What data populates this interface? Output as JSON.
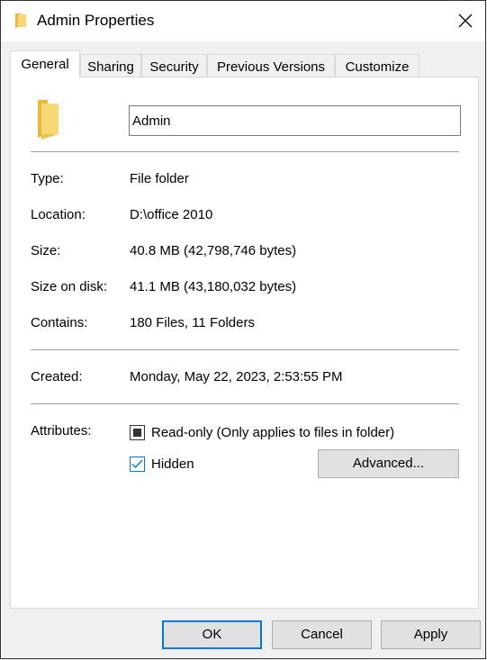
{
  "window": {
    "title": "Admin Properties",
    "close_icon": "close-icon"
  },
  "tabs": [
    {
      "label": "General",
      "active": true
    },
    {
      "label": "Sharing",
      "active": false
    },
    {
      "label": "Security",
      "active": false
    },
    {
      "label": "Previous Versions",
      "active": false
    },
    {
      "label": "Customize",
      "active": false
    }
  ],
  "general": {
    "folder_name": "Admin",
    "rows": [
      {
        "label": "Type:",
        "value": "File folder"
      },
      {
        "label": "Location:",
        "value": "D:\\office 2010"
      },
      {
        "label": "Size:",
        "value": "40.8 MB (42,798,746 bytes)"
      },
      {
        "label": "Size on disk:",
        "value": "41.1 MB (43,180,032 bytes)"
      },
      {
        "label": "Contains:",
        "value": "180 Files, 11 Folders"
      }
    ],
    "created": {
      "label": "Created:",
      "value": "Monday, May 22, 2023, 2:53:55 PM"
    },
    "attributes": {
      "label": "Attributes:",
      "readonly": {
        "label": "Read-only (Only applies to files in folder)",
        "state": "indeterminate"
      },
      "hidden": {
        "label": "Hidden",
        "state": "checked"
      },
      "advanced_label": "Advanced..."
    }
  },
  "buttons": {
    "ok": "OK",
    "cancel": "Cancel",
    "apply": "Apply"
  }
}
